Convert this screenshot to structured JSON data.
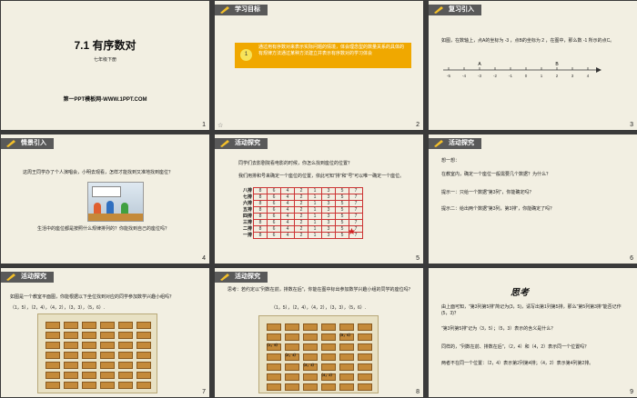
{
  "slides": [
    {
      "num": "1",
      "title": "7.1  有序数对",
      "subtitle": "七年级下册",
      "footer": "第一PPT模板网-WWW.1PPT.COM"
    },
    {
      "num": "2",
      "header": "学习目标",
      "goal_index": "1",
      "goal_text": "通过用有序数对来表示实际问题的情境，体会理念型的数量关系的具体的有规律方法通过某种方法建立并表示有序数对的学习体会"
    },
    {
      "num": "3",
      "header": "复习引入",
      "text": "如图，在数轴上，点A的坐标为  -3 ，点B的坐标为  2 ，在图中，那么数 -1 所示的点C。",
      "axis_labels": [
        "-5",
        "-4",
        "-3",
        "-2",
        "-1",
        "0",
        "1",
        "2",
        "3",
        "4"
      ],
      "point_a": "A",
      "point_b": "B"
    },
    {
      "num": "4",
      "header": "情景引入",
      "text": "这周王同学办了个人演唱会，小明去观看，怎样才能找到又准地找到座位？",
      "text2": "生活中的座位都是按照什么规律排列的？你能找到自己的座位吗？"
    },
    {
      "num": "5",
      "header": "活动探究",
      "text": "同学们去影剧院看电影的时候，你怎么找到座位的位置？",
      "text2": "我们用排和号来确定一个座位的位置，依此可知\"排\"和\"号\"可以唯一确定一个座位。",
      "rows": [
        "八排",
        "七排",
        "六排",
        "五排",
        "四排",
        "三排",
        "二排",
        "一排"
      ],
      "seats": [
        "8",
        "6",
        "4",
        "2",
        "1",
        "3",
        "5",
        "7"
      ]
    },
    {
      "num": "6",
      "header": "活动探究",
      "q1": "想一想：",
      "q2": "在教室内，确定一个座位一般需要几个数据？为什么？",
      "q3": "提示一：只给一个数据\"第3列\"，你能确定吗？",
      "q4": "提示二：给出两个数据\"第3列，第3排\"，你能确定了吗？"
    },
    {
      "num": "7",
      "header": "活动探究",
      "text": "如图是一个教室平面图，你能根据以下坐位找到对应的同学参加数学兴趣小组吗？",
      "pairs": "（1，5），（2，4），（4，2），（3，3），（5，6）."
    },
    {
      "num": "8",
      "header": "活动探究",
      "text": "思考：若约定以\"列数在前，排数在后\"，你能在图中标出参加数学兴趣小组的同学的座位吗？",
      "pairs": "（1，5），（2，4），（4，2），（3，3），（5，6）.",
      "marks": [
        "（1，5）",
        "（2，4）",
        "（4，2）",
        "（3，3）",
        "（5，6）"
      ]
    },
    {
      "num": "9",
      "think": "思考",
      "lines": [
        "由上面可知，\"第3列第5排\"简记为(3，5)，请写出第1列第5排，那么\"第5列第3排\"能否记作(5，3)？",
        "\"第3列第5排\"记为（3，5）；（5，3）表示的含义是什么？",
        "同样的，\"列数在前、排数在后\"，（2，4）和（4，2）表示同一个位置吗？",
        "两者不在同一个位置：（2，4）表示第2列第4排；（4，2）表示第4列第2排。"
      ]
    }
  ]
}
